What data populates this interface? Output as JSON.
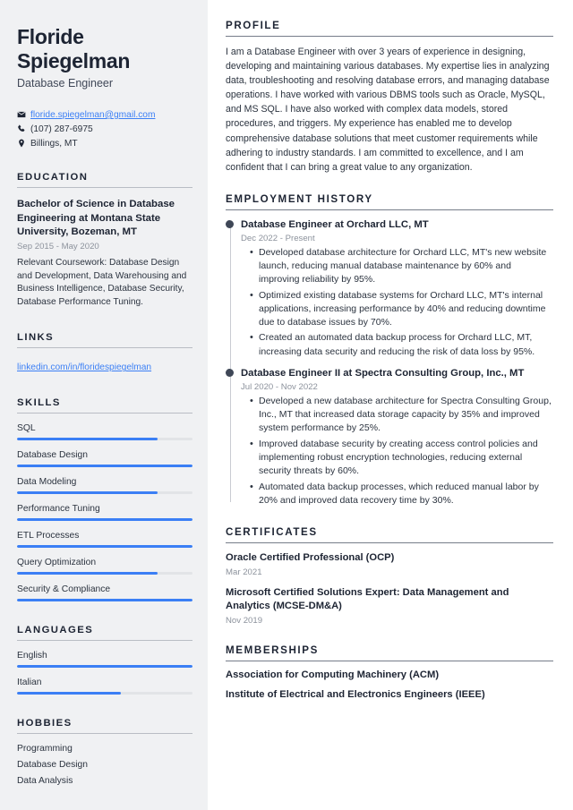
{
  "sidebar": {
    "name": "Floride Spiegelman",
    "job_title": "Database Engineer",
    "contact": {
      "email": "floride.spiegelman@gmail.com",
      "phone": "(107) 287-6975",
      "location": "Billings, MT"
    },
    "education": {
      "heading": "EDUCATION",
      "entries": [
        {
          "title": "Bachelor of Science in Database Engineering at Montana State University, Bozeman, MT",
          "date": "Sep 2015 - May 2020",
          "description": "Relevant Coursework: Database Design and Development, Data Warehousing and Business Intelligence, Database Security, Database Performance Tuning."
        }
      ]
    },
    "links": {
      "heading": "LINKS",
      "items": [
        {
          "label": "linkedin.com/in/floridespiegelman"
        }
      ]
    },
    "skills": {
      "heading": "SKILLS",
      "items": [
        {
          "label": "SQL",
          "level": 80
        },
        {
          "label": "Database Design",
          "level": 100
        },
        {
          "label": "Data Modeling",
          "level": 80
        },
        {
          "label": "Performance Tuning",
          "level": 100
        },
        {
          "label": "ETL Processes",
          "level": 100
        },
        {
          "label": "Query Optimization",
          "level": 80
        },
        {
          "label": "Security & Compliance",
          "level": 100
        }
      ]
    },
    "languages": {
      "heading": "LANGUAGES",
      "items": [
        {
          "label": "English",
          "level": 100
        },
        {
          "label": "Italian",
          "level": 59
        }
      ]
    },
    "hobbies": {
      "heading": "HOBBIES",
      "items": [
        {
          "label": "Programming"
        },
        {
          "label": "Database Design"
        },
        {
          "label": "Data Analysis"
        }
      ]
    }
  },
  "main": {
    "profile": {
      "heading": "PROFILE",
      "text": "I am a Database Engineer with over 3 years of experience in designing, developing and maintaining various databases. My expertise lies in analyzing data, troubleshooting and resolving database errors, and managing database operations. I have worked with various DBMS tools such as Oracle, MySQL, and MS SQL. I have also worked with complex data models, stored procedures, and triggers. My experience has enabled me to develop comprehensive database solutions that meet customer requirements while adhering to industry standards. I am committed to excellence, and I am confident that I can bring a great value to any organization."
    },
    "employment": {
      "heading": "EMPLOYMENT HISTORY",
      "jobs": [
        {
          "role": "Database Engineer at Orchard LLC, MT",
          "date": "Dec 2022 - Present",
          "bullets": [
            "Developed database architecture for Orchard LLC, MT's new website launch, reducing manual database maintenance by 60% and improving reliability by 95%.",
            "Optimized existing database systems for Orchard LLC, MT's internal applications, increasing performance by 40% and reducing downtime due to database issues by 70%.",
            "Created an automated data backup process for Orchard LLC, MT, increasing data security and reducing the risk of data loss by 95%."
          ]
        },
        {
          "role": "Database Engineer II at Spectra Consulting Group, Inc., MT",
          "date": "Jul 2020 - Nov 2022",
          "bullets": [
            "Developed a new database architecture for Spectra Consulting Group, Inc., MT that increased data storage capacity by 35% and improved system performance by 25%.",
            "Improved database security by creating access control policies and implementing robust encryption technologies, reducing external security threats by 60%.",
            "Automated data backup processes, which reduced manual labor by 20% and improved data recovery time by 30%."
          ]
        }
      ]
    },
    "certificates": {
      "heading": "CERTIFICATES",
      "items": [
        {
          "title": "Oracle Certified Professional (OCP)",
          "date": "Mar 2021"
        },
        {
          "title": "Microsoft Certified Solutions Expert: Data Management and Analytics (MCSE-DM&A)",
          "date": "Nov 2019"
        }
      ]
    },
    "memberships": {
      "heading": "MEMBERSHIPS",
      "items": [
        {
          "label": "Association for Computing Machinery (ACM)"
        },
        {
          "label": "Institute of Electrical and Electronics Engineers (IEEE)"
        }
      ]
    }
  },
  "colors": {
    "accent": "#3b7ff5",
    "heading": "#1d2433",
    "sidebar_bg": "#f0f1f3",
    "muted": "#8c929c"
  }
}
